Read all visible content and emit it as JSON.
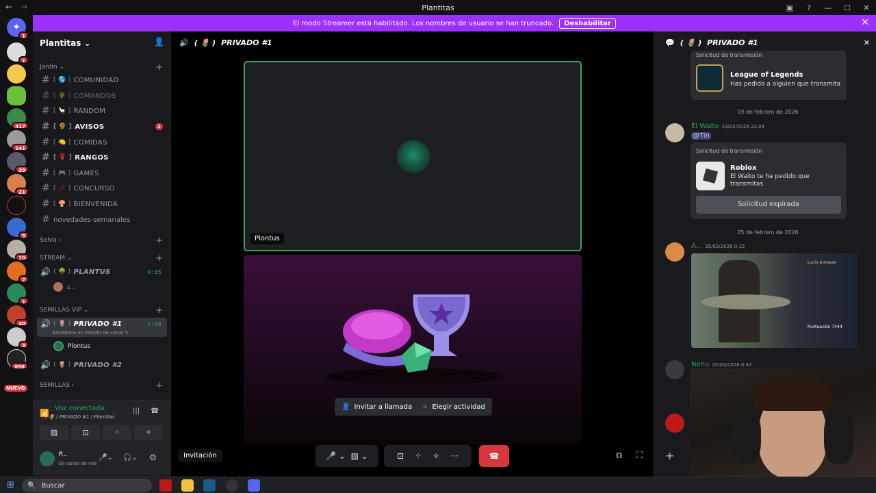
{
  "window": {
    "title": "Plantitas"
  },
  "banner": {
    "text": "El modo Streamer está habilitado. Los nombres de usuario se han truncado.",
    "button": "Deshabilitar"
  },
  "servers": {
    "badges": [
      "1",
      "1",
      "417",
      "141",
      "39",
      "21",
      "5",
      "10",
      "2",
      "1",
      "40",
      "3",
      "658"
    ],
    "new_label": "NUEVO"
  },
  "sidebar": {
    "server_name": "Plantitas",
    "categories": {
      "jardin": "Jardín",
      "selva": "Selva",
      "stream": "STREAM",
      "vip": "SEMILLAS VIP",
      "semillas": "SEMILLAS"
    },
    "channels": [
      {
        "label": "COMUNIDAD",
        "emoji": "🌎"
      },
      {
        "label": "COMANDOS",
        "emoji": "🌵"
      },
      {
        "label": "RANDOM",
        "emoji": "🦙"
      },
      {
        "label": "AVISOS",
        "emoji": "🌻",
        "unread": "1"
      },
      {
        "label": "COMIDAS",
        "emoji": "🍋"
      },
      {
        "label": "RANGOS",
        "emoji": "🌹"
      },
      {
        "label": "GAMES",
        "emoji": "🎮"
      },
      {
        "label": "CONCURSO",
        "emoji": "🥢"
      },
      {
        "label": "BIENVENIDA",
        "emoji": "🍄"
      },
      {
        "label": "novedades-semanales",
        "emoji": ""
      }
    ],
    "voice": {
      "plantus": {
        "label": "PLANTUS",
        "emoji": "🌳",
        "time": "0:05",
        "member": "s..."
      },
      "privado1": {
        "label": "PRIVADO #1",
        "emoji": "🌷",
        "time": "1:48",
        "status": "Establece un estado de canal",
        "member": "Plontus"
      },
      "privado2": {
        "label": "PRIVADO #2",
        "emoji": "🌷"
      }
    }
  },
  "voicepanel": {
    "status": "Voz conectada",
    "channel": "( 🌷 ) PRIVADO #1 / Plantitas",
    "user": "P...",
    "user_status": "En canal de voz"
  },
  "main": {
    "channel_title": "PRIVADO #1",
    "channel_emoji": "🌷",
    "tile_name": "Plontus",
    "invite_btn": "Invitar a llamada",
    "activity_btn": "Elegir actividad",
    "invite_tooltip": "Invitación"
  },
  "chat": {
    "title": "PRIVADO #1",
    "card1": {
      "label": "Solicitud de transmisión",
      "game": "League of Legends",
      "desc": "Has pedido a alguien que transmita"
    },
    "date1": "19 de febrero de 2026",
    "msg1": {
      "author": "El Waito",
      "time": "19/02/2026 22:04",
      "mention": "@Tin"
    },
    "card2": {
      "label": "Solicitud de transmisión",
      "game": "Roblox",
      "desc": "El Waito te ha pedido que transmitas",
      "button": "Solicitud expirada"
    },
    "date2": "25 de febrero de 2026",
    "msg2": {
      "author": "A...",
      "time": "25/02/2026 0:15"
    },
    "msg3": {
      "author": "Nehu",
      "time": "25/02/2026 0:47"
    },
    "shot": {
      "title": "Lucio europeo",
      "score_label": "Puntuación",
      "score": "7444"
    }
  },
  "taskbar": {
    "search": "Buscar"
  },
  "colors": {
    "banner": "#9b30ff",
    "speaking": "#3ba55d",
    "online": "#23a55a",
    "hangup": "#da373c"
  }
}
